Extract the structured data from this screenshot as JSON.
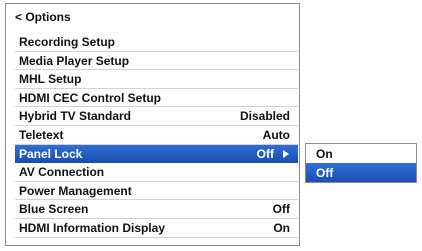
{
  "header": {
    "title": "< Options"
  },
  "menu": {
    "items": [
      {
        "label": "Recording Setup",
        "value": ""
      },
      {
        "label": "Media Player Setup",
        "value": ""
      },
      {
        "label": "MHL Setup",
        "value": ""
      },
      {
        "label": "HDMI CEC Control Setup",
        "value": ""
      },
      {
        "label": "Hybrid TV Standard",
        "value": "Disabled"
      },
      {
        "label": "Teletext",
        "value": "Auto"
      },
      {
        "label": "Panel Lock",
        "value": "Off"
      },
      {
        "label": "AV Connection",
        "value": ""
      },
      {
        "label": "Power Management",
        "value": ""
      },
      {
        "label": "Blue Screen",
        "value": "Off"
      },
      {
        "label": "HDMI Information Display",
        "value": "On"
      }
    ],
    "selected_index": 6
  },
  "submenu": {
    "options": [
      {
        "label": "On"
      },
      {
        "label": "Off"
      }
    ],
    "selected_index": 1
  },
  "colors": {
    "highlight": "#1f5cc2",
    "border": "#8c8c8c",
    "separator": "#d2d2d2"
  }
}
